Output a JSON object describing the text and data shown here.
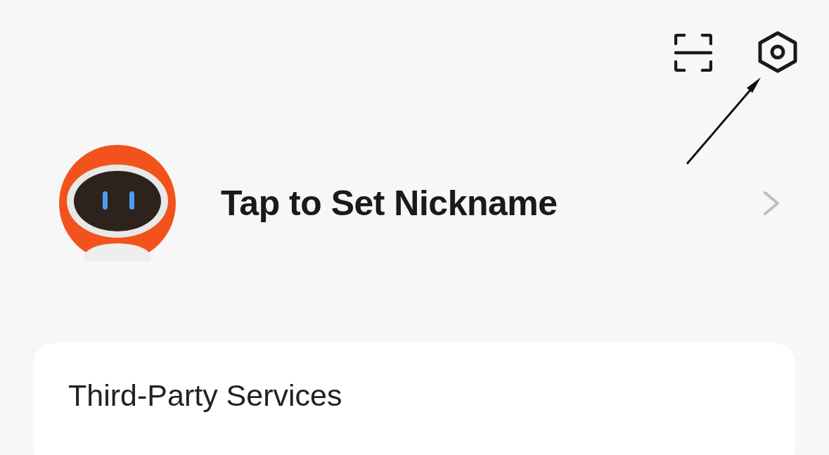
{
  "profile": {
    "nickname": "Tap to Set Nickname"
  },
  "card": {
    "title": "Third-Party Services"
  }
}
